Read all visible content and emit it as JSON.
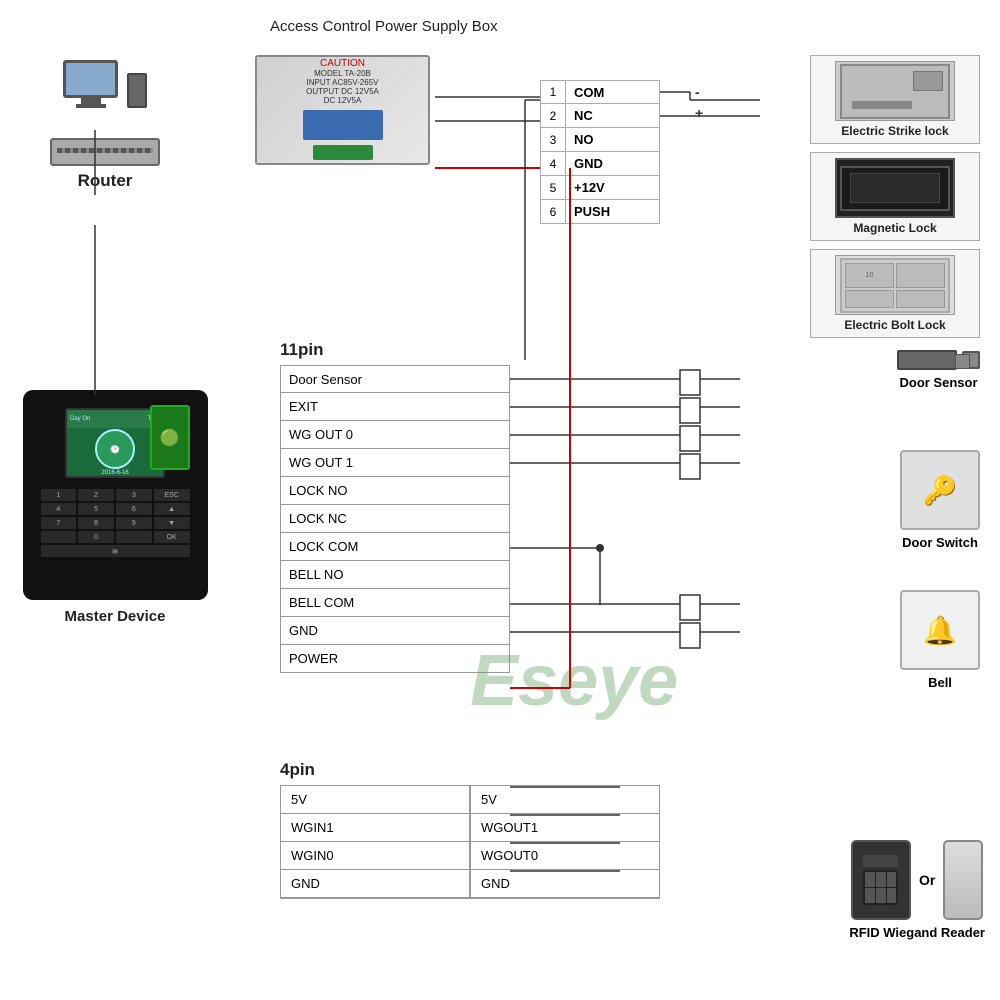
{
  "title": "Access Control Power Supply Box",
  "router_label": "Router",
  "master_label": "Master Device",
  "eseye": "Eseye",
  "pin11_title": "11pin",
  "pin4_title": "4pin",
  "terminal": {
    "rows": [
      {
        "num": "1",
        "label": "COM"
      },
      {
        "num": "2",
        "label": "NC"
      },
      {
        "num": "3",
        "label": "NO"
      },
      {
        "num": "4",
        "label": "GND"
      },
      {
        "num": "5",
        "label": "+12V"
      },
      {
        "num": "6",
        "label": "PUSH"
      }
    ]
  },
  "pin11_rows": [
    "Door Sensor",
    "EXIT",
    "WG OUT 0",
    "WG OUT 1",
    "LOCK NO",
    "LOCK NC",
    "LOCK COM",
    "BELL NO",
    "BELL COM",
    "GND",
    "POWER"
  ],
  "pin4_left": [
    "5V",
    "WGIN1",
    "WGIN0",
    "GND"
  ],
  "pin4_right": [
    "5V",
    "WGOUT1",
    "WGOUT0",
    "GND"
  ],
  "locks": [
    {
      "label": "Electric Strike lock"
    },
    {
      "label": "Magnetic Lock"
    },
    {
      "label": "Electric Bolt Lock"
    }
  ],
  "door_sensor_label": "Door Sensor",
  "door_switch_label": "Door Switch",
  "bell_label": "Bell",
  "rfid_label": "RFID Wiegand Reader",
  "or_text": "Or"
}
